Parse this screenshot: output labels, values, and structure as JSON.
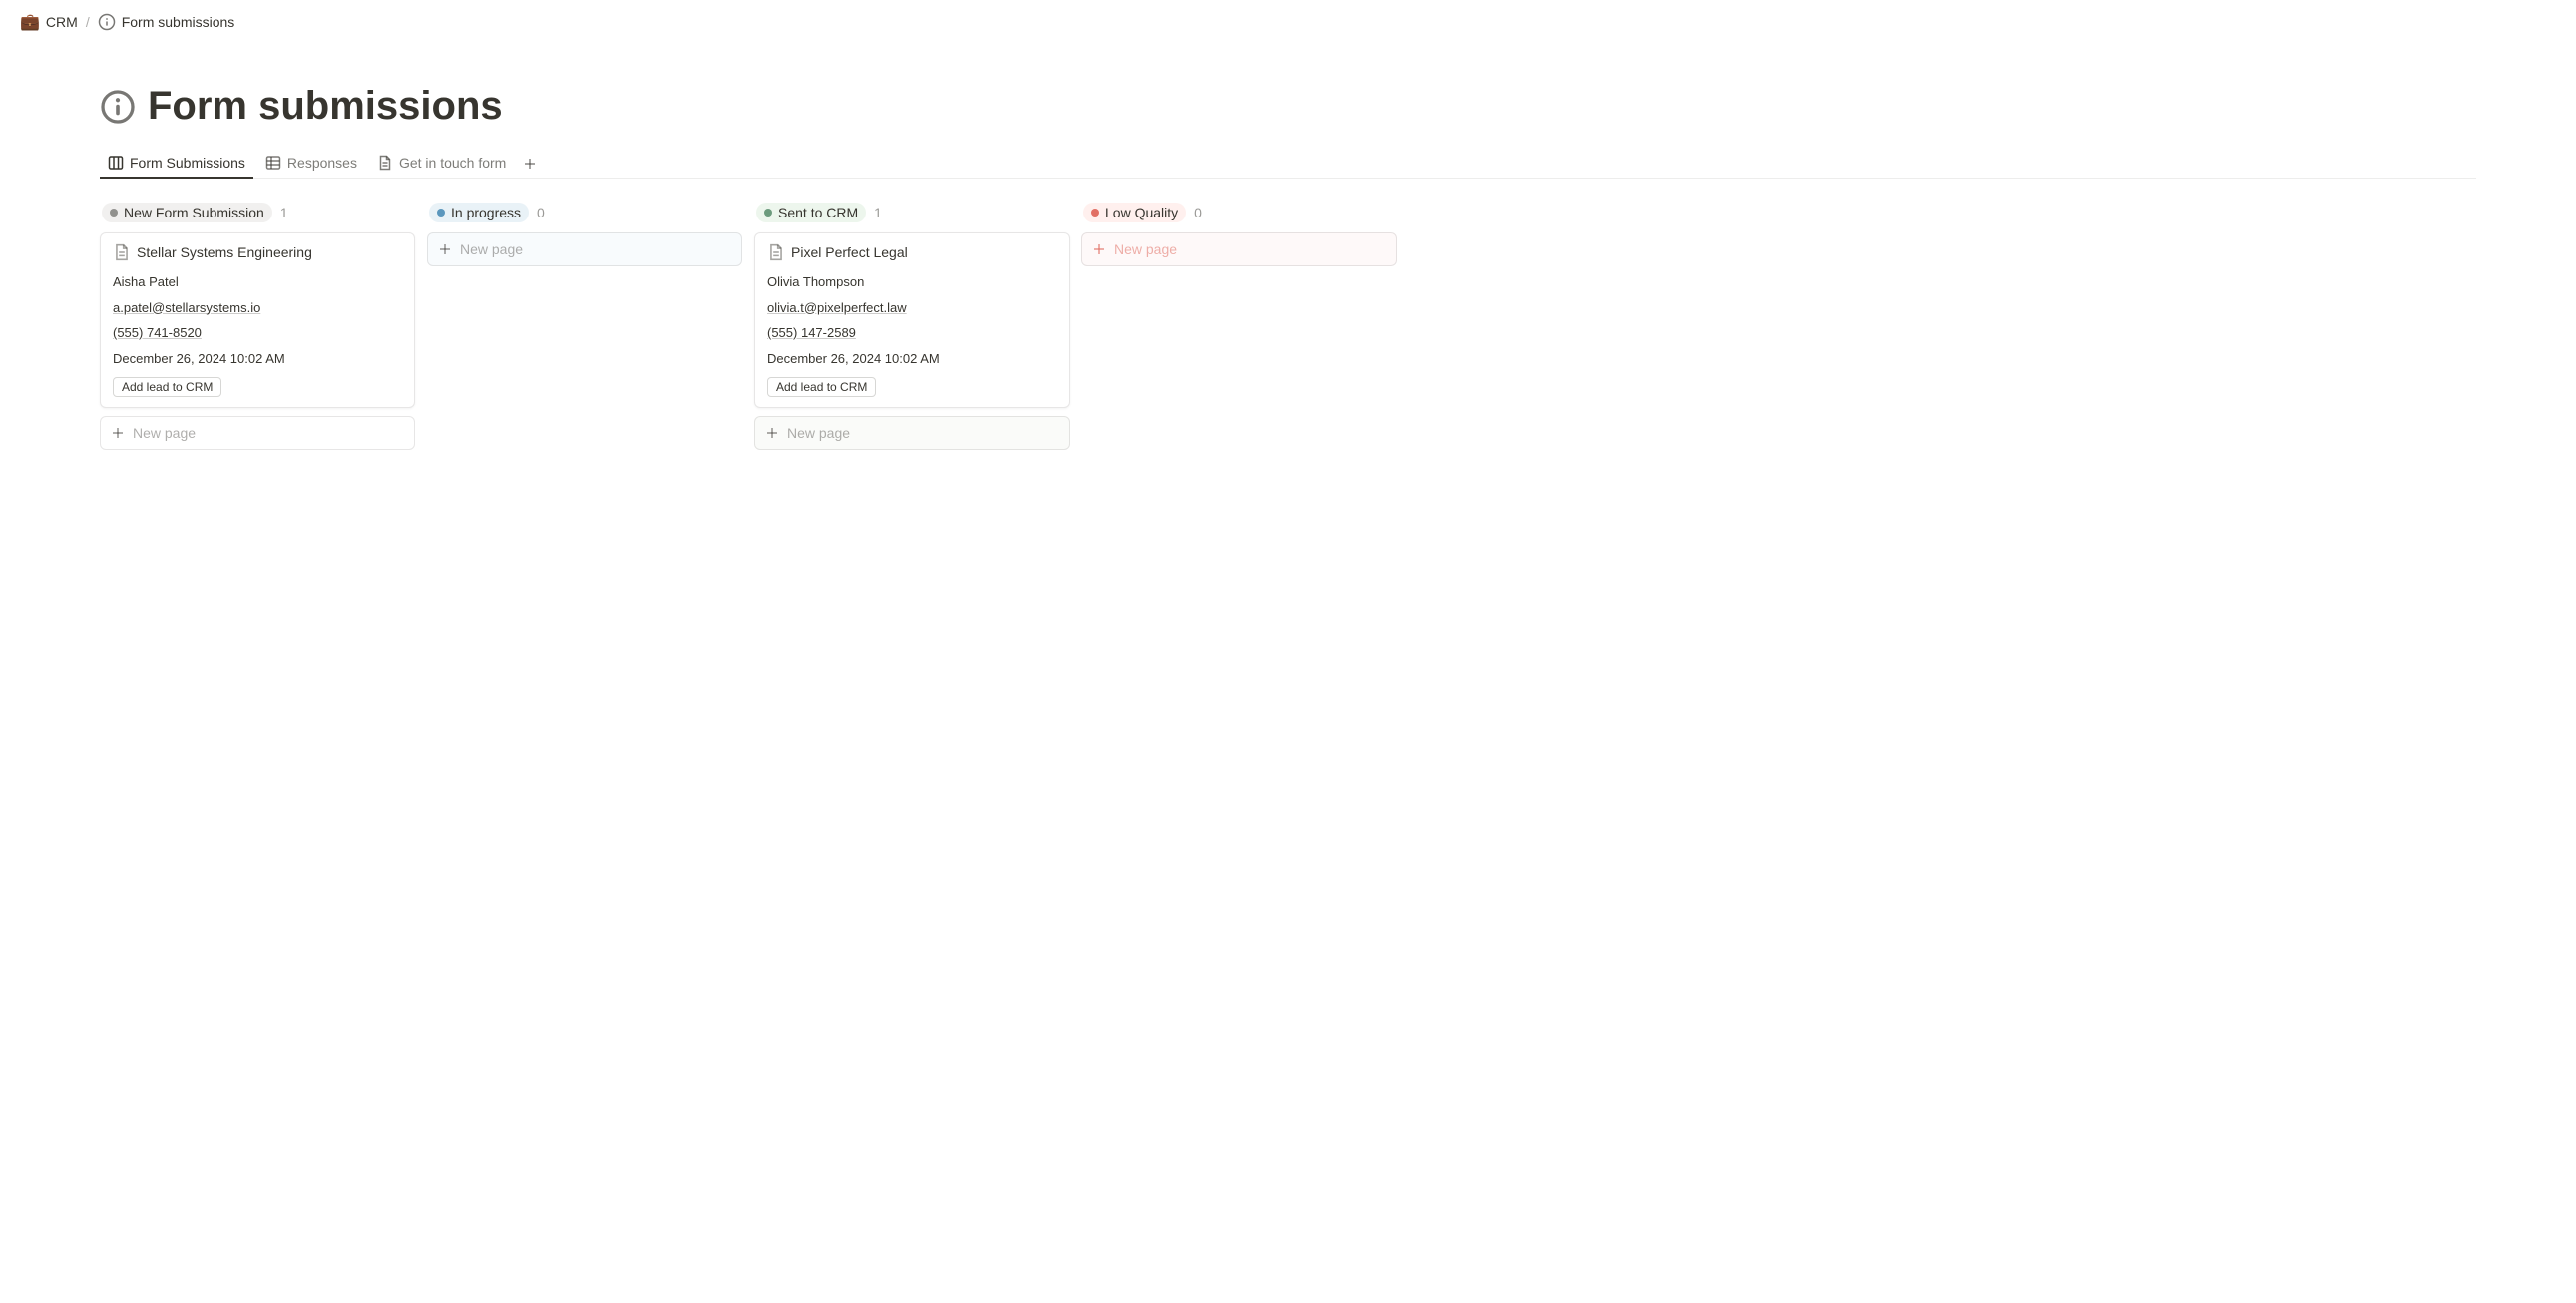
{
  "breadcrumb": {
    "root_emoji": "💼",
    "root_label": "CRM",
    "separator": "/",
    "page_label": "Form submissions"
  },
  "page": {
    "title": "Form submissions"
  },
  "tabs": {
    "items": [
      {
        "label": "Form Submissions",
        "icon": "board-icon",
        "active": true
      },
      {
        "label": "Responses",
        "icon": "table-icon",
        "active": false
      },
      {
        "label": "Get in touch form",
        "icon": "page-icon",
        "active": false
      }
    ]
  },
  "board": {
    "columns": [
      {
        "status_label": "New Form Submission",
        "pill_class": "pill-gray",
        "dot_class": "dot-gray",
        "count": "1",
        "tint_class": "",
        "cards": [
          {
            "title": "Stellar Systems Engineering",
            "contact_name": "Aisha Patel",
            "email": "a.patel@stellarsystems.io",
            "phone": "(555) 741-8520",
            "timestamp": "December 26, 2024 10:02 AM",
            "button_label": "Add lead to CRM"
          }
        ],
        "new_page_label": "New page"
      },
      {
        "status_label": "In progress",
        "pill_class": "pill-blue",
        "dot_class": "dot-blue",
        "count": "0",
        "tint_class": "tinted-blue",
        "cards": [],
        "new_page_label": "New page"
      },
      {
        "status_label": "Sent to CRM",
        "pill_class": "pill-green",
        "dot_class": "dot-green",
        "count": "1",
        "tint_class": "tinted-green",
        "cards": [
          {
            "title": "Pixel Perfect Legal",
            "contact_name": "Olivia Thompson",
            "email": "olivia.t@pixelperfect.law",
            "phone": "(555) 147-2589",
            "timestamp": "December 26, 2024 10:02 AM",
            "button_label": "Add lead to CRM"
          }
        ],
        "new_page_label": "New page"
      },
      {
        "status_label": "Low Quality",
        "pill_class": "pill-red",
        "dot_class": "dot-red",
        "count": "0",
        "tint_class": "tinted-red",
        "cards": [],
        "new_page_label": "New page"
      }
    ]
  }
}
